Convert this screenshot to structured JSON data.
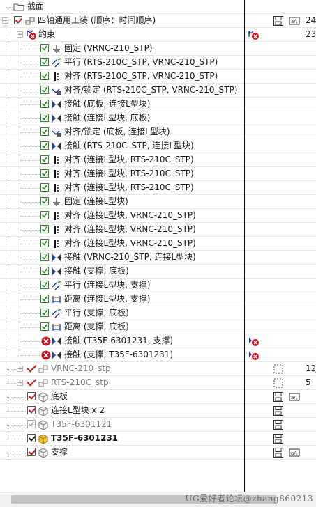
{
  "colors": {
    "check_red": "#d6181f",
    "icon_green": "#2e8b2e",
    "error_red": "#d0101a",
    "blue": "#1d3fa8"
  },
  "section_root": {
    "label": "截面",
    "icon": "folder-icon"
  },
  "assembly": {
    "label": "四轴通用工装 (顺序：时间顺序)",
    "icon": "assembly-icon",
    "col_num": "24"
  },
  "constraints": {
    "label": "约束",
    "icon": "constraint-folder-error-icon",
    "col_num": "23"
  },
  "constraint_items": [
    {
      "label": "固定 (VRNC-210_STP)",
      "icon": "ground-icon",
      "status": "ok"
    },
    {
      "label": "平行 (RTS-210C_STP, VRNC-210_STP)",
      "icon": "parallel-icon",
      "status": "ok"
    },
    {
      "label": "对齐 (RTS-210C_STP, VRNC-210_STP)",
      "icon": "align-icon",
      "status": "ok"
    },
    {
      "label": "对齐/锁定 (RTS-210C_STP, VRNC-210_STP)",
      "icon": "align-lock-icon",
      "status": "ok"
    },
    {
      "label": "接触 (底板, 连接L型块)",
      "icon": "contact-icon",
      "status": "ok"
    },
    {
      "label": "接触 (连接L型块, 底板)",
      "icon": "contact-icon",
      "status": "ok"
    },
    {
      "label": "对齐/锁定 (底板, 连接L型块)",
      "icon": "align-lock-icon",
      "status": "ok"
    },
    {
      "label": "接触 (RTS-210C_STP, 连接L型块)",
      "icon": "contact-icon",
      "status": "ok"
    },
    {
      "label": "对齐 (连接L型块, RTS-210C_STP)",
      "icon": "align-icon",
      "status": "ok"
    },
    {
      "label": "对齐 (连接L型块, RTS-210C_STP)",
      "icon": "align-icon",
      "status": "ok"
    },
    {
      "label": "对齐 (连接L型块, RTS-210C_STP)",
      "icon": "align-icon",
      "status": "ok"
    },
    {
      "label": "固定 (连接L型块)",
      "icon": "ground-icon",
      "status": "ok"
    },
    {
      "label": "对齐 (连接L型块, VRNC-210_STP)",
      "icon": "align-icon",
      "status": "ok"
    },
    {
      "label": "对齐 (连接L型块, VRNC-210_STP)",
      "icon": "align-icon",
      "status": "ok"
    },
    {
      "label": "对齐 (连接L型块, VRNC-210_STP)",
      "icon": "align-icon",
      "status": "ok"
    },
    {
      "label": "接触 (VRNC-210_STP, 连接L型块)",
      "icon": "contact-icon",
      "status": "ok"
    },
    {
      "label": "接触 (支撑, 底板)",
      "icon": "contact-icon",
      "status": "ok"
    },
    {
      "label": "平行 (连接L型块, 支撑)",
      "icon": "parallel-icon",
      "status": "ok"
    },
    {
      "label": "距离 (连接L型块, 支撑)",
      "icon": "distance-icon",
      "status": "ok"
    },
    {
      "label": "平行 (支撑, 底板)",
      "icon": "parallel-icon",
      "status": "ok"
    },
    {
      "label": "距离 (支撑, 底板)",
      "icon": "distance-icon",
      "status": "ok"
    },
    {
      "label": "接触 (T35F-6301231, 支撑)",
      "icon": "contact-icon",
      "status": "error"
    },
    {
      "label": "接触 (支撑, T35F-6301231)",
      "icon": "contact-icon",
      "status": "error"
    }
  ],
  "components": [
    {
      "label": "VRNC-210_stp",
      "style": "gray",
      "icon": "subassembly-icon",
      "col_icon": "placeholder-icon",
      "col_num": "12",
      "expander": true,
      "check": "redcheck"
    },
    {
      "label": "RTS-210C_stp",
      "style": "gray",
      "icon": "subassembly-icon",
      "col_icon": "placeholder-icon",
      "col_num": "5",
      "expander": true,
      "check": "redcheck"
    },
    {
      "label": "底板",
      "style": "normal",
      "icon": "part-icon",
      "col_icon": "save-icon",
      "col_icon2": "dimension-icon",
      "check": "box"
    },
    {
      "label": "连接L型块 x 2",
      "style": "normal",
      "icon": "part-icon",
      "col_icon": "save-icon",
      "check": "box"
    },
    {
      "label": "T35F-6301121",
      "style": "gray",
      "icon": "part-icon",
      "col_icon": "save-icon",
      "check": "box-gray"
    },
    {
      "label": "T35F-6301231",
      "style": "bold",
      "icon": "part-yellow-icon",
      "col_icon": "save-icon",
      "check": "box-dark"
    },
    {
      "label": "支撑",
      "style": "normal",
      "icon": "part-icon",
      "col_icon": "save-icon",
      "col_icon2": "dimension-icon",
      "check": "box"
    }
  ],
  "watermark": "UG爱好者论坛@zhang860213"
}
